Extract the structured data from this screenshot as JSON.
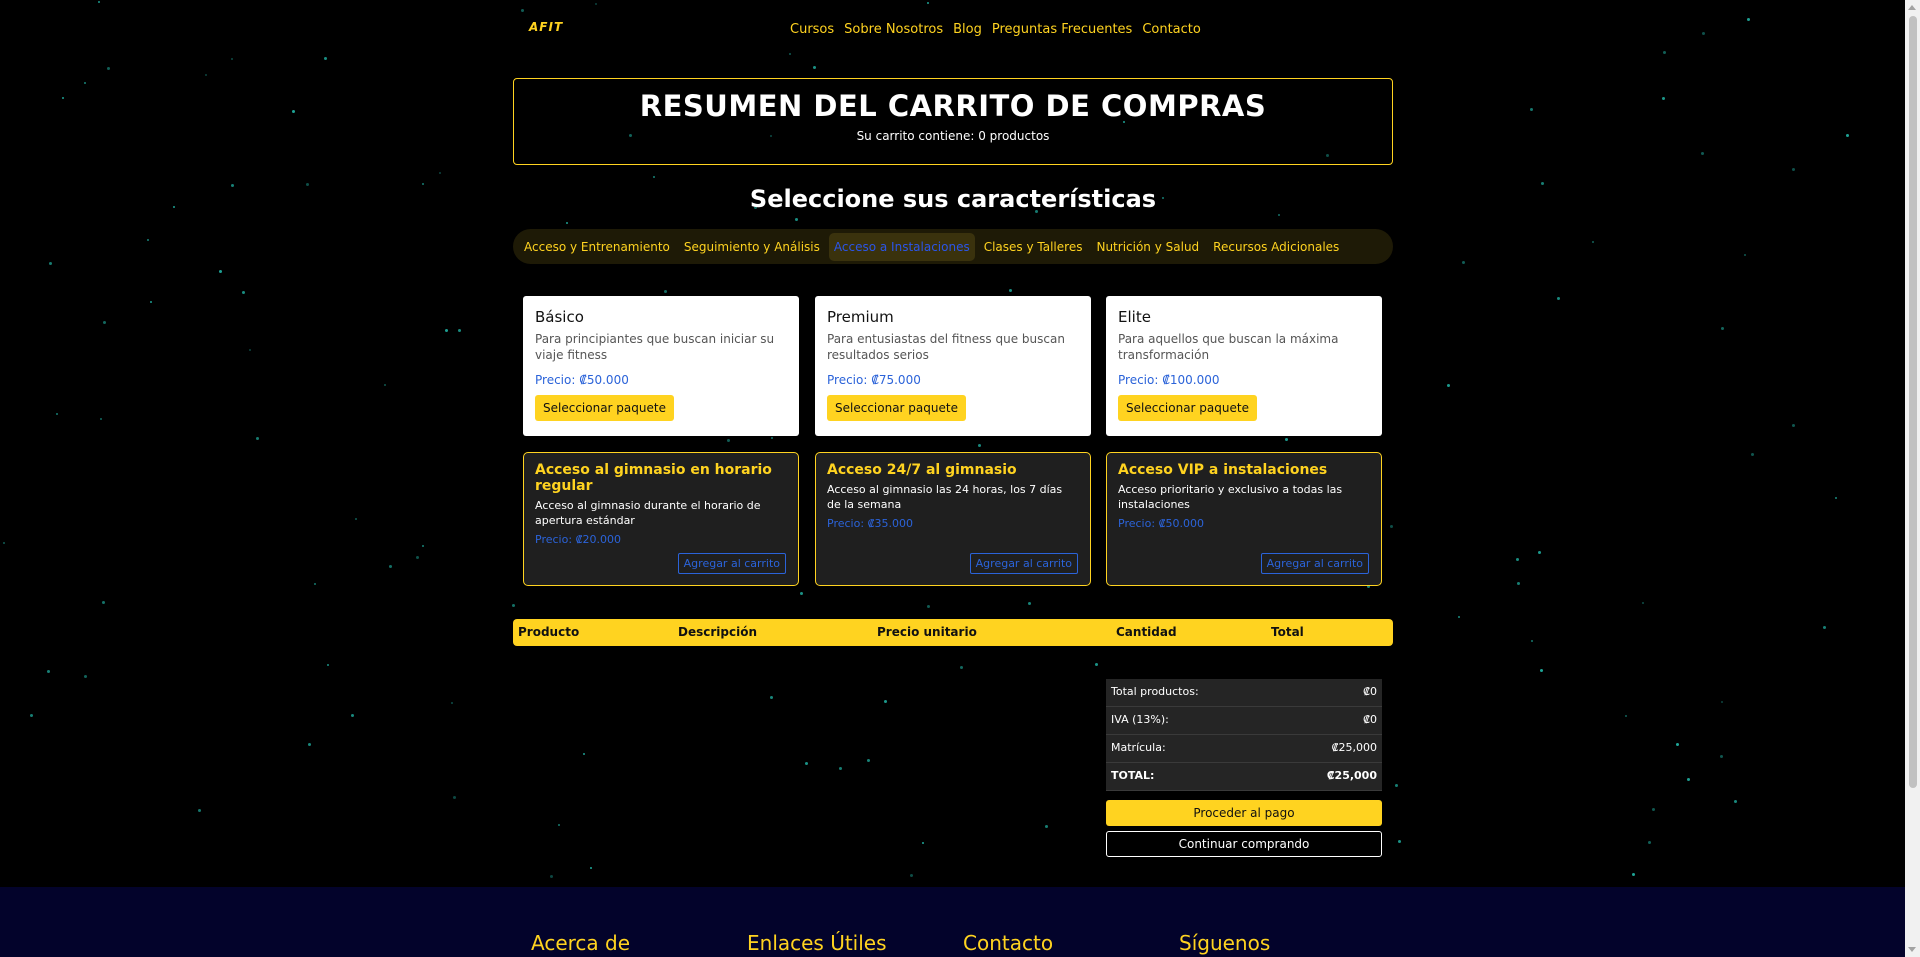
{
  "header": {
    "logo": "AFIT",
    "nav": [
      "Cursos",
      "Sobre Nosotros",
      "Blog",
      "Preguntas Frecuentes",
      "Contacto"
    ]
  },
  "summary": {
    "title": "RESUMEN DEL CARRITO DE COMPRAS",
    "subtitle": "Su carrito contiene: 0 productos"
  },
  "features_title": "Seleccione sus características",
  "tabs": [
    {
      "label": "Acceso y Entrenamiento",
      "active": false
    },
    {
      "label": "Seguimiento y Análisis",
      "active": false
    },
    {
      "label": "Acceso a Instalaciones",
      "active": true
    },
    {
      "label": "Clases y Talleres",
      "active": false
    },
    {
      "label": "Nutrición y Salud",
      "active": false
    },
    {
      "label": "Recursos Adicionales",
      "active": false
    }
  ],
  "packages": [
    {
      "name": "Básico",
      "description": "Para principiantes que buscan iniciar su viaje fitness",
      "price": "Precio: ₡50.000",
      "button": "Seleccionar paquete"
    },
    {
      "name": "Premium",
      "description": "Para entusiastas del fitness que buscan resultados serios",
      "price": "Precio: ₡75.000",
      "button": "Seleccionar paquete"
    },
    {
      "name": "Elite",
      "description": "Para aquellos que buscan la máxima transformación",
      "price": "Precio: ₡100.000",
      "button": "Seleccionar paquete"
    }
  ],
  "features": [
    {
      "name": "Acceso al gimnasio en horario regular",
      "description": "Acceso al gimnasio durante el horario de apertura estándar",
      "price": "Precio: ₡20.000",
      "button": "Agregar al carrito"
    },
    {
      "name": "Acceso 24/7 al gimnasio",
      "description": "Acceso al gimnasio las 24 horas, los 7 días de la semana",
      "price": "Precio: ₡35.000",
      "button": "Agregar al carrito"
    },
    {
      "name": "Acceso VIP a instalaciones",
      "description": "Acceso prioritario y exclusivo a todas las instalaciones",
      "price": "Precio: ₡50.000",
      "button": "Agregar al carrito"
    }
  ],
  "cart_table": {
    "columns": [
      "Producto",
      "Descripción",
      "Precio unitario",
      "Cantidad",
      "Total"
    ]
  },
  "totals": [
    {
      "label": "Total productos:",
      "value": "₡0"
    },
    {
      "label": "IVA (13%):",
      "value": "₡0"
    },
    {
      "label": "Matrícula:",
      "value": "₡25,000"
    },
    {
      "label": "TOTAL:",
      "value": "₡25,000"
    }
  ],
  "buttons": {
    "pay": "Proceder al pago",
    "continue": "Continuar comprando"
  },
  "footer": {
    "sections": [
      "Acerca de",
      "Enlaces Útiles",
      "Contacto",
      "Síguenos"
    ]
  },
  "colors": {
    "accent": "#ffd320",
    "link_blue": "#2b63d9",
    "star": "#1fa89a",
    "footer_bg": "#03032b"
  }
}
